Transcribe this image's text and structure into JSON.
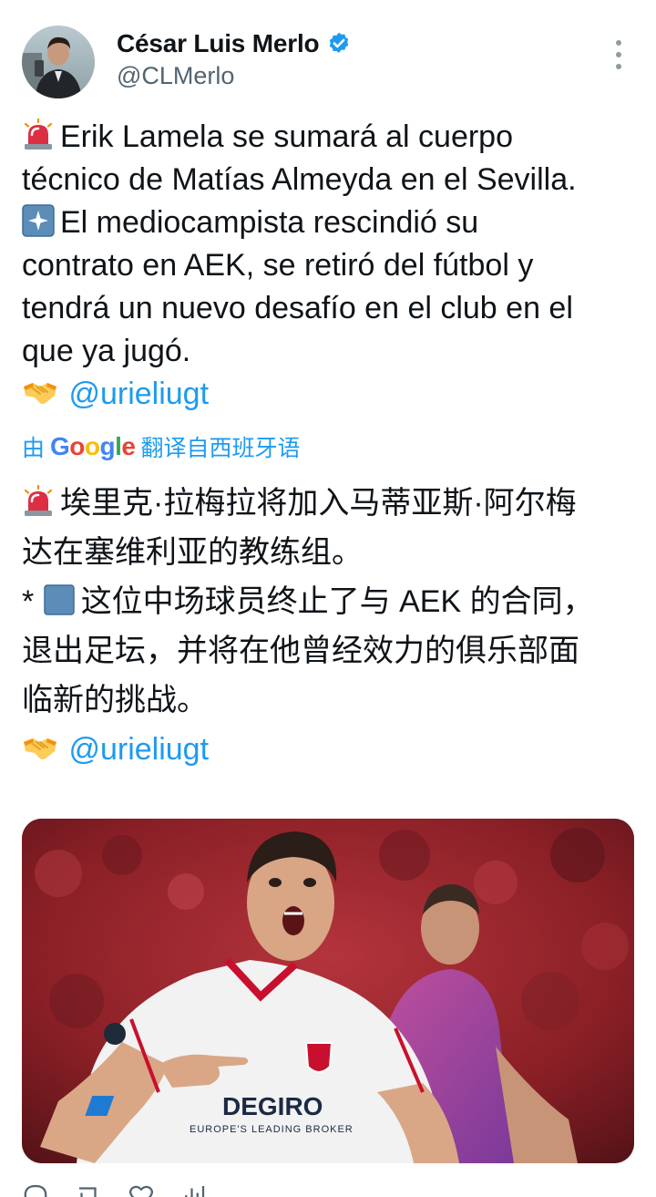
{
  "author": {
    "display_name": "César Luis Merlo",
    "handle": "@CLMerlo",
    "verified": true
  },
  "tweet": {
    "line1": "Erik Lamela se sumará al cuerpo",
    "line2": "técnico de Matías Almeyda en el Sevilla.",
    "line3": "El mediocampista rescindió su",
    "line4": "contrato en AEK, se retiró del fútbol y",
    "line5": "tendrá un nuevo desafío en el club en el",
    "line6": "que ya jugó.",
    "mention": "@urieliugt"
  },
  "translation": {
    "prefix": "由",
    "provider_letters": [
      "G",
      "o",
      "o",
      "g",
      "l",
      "e"
    ],
    "suffix": "翻译自西班牙语",
    "line1": "埃里克·拉梅拉将加入马蒂亚斯·阿尔梅",
    "line2": "达在塞维利亚的教练组。",
    "line3_star": "* ",
    "line3": "这位中场球员终止了与 AEK 的合同，",
    "line4": "退出足坛，并将在他曾经效力的俱乐部面",
    "line5": "临新的挑战。",
    "mention": "@urieliugt"
  },
  "photo": {
    "sponsor": "DEGIRO",
    "sponsor_tagline": "EUROPE'S LEADING BROKER"
  },
  "icons": {
    "alarm": "rotating-light-icon",
    "sparkle": "sparkles-button-icon",
    "handshake": "handshake-icon",
    "verified": "verified-badge-icon",
    "more": "more-vertical-icon"
  },
  "colors": {
    "link": "#1d9bf0",
    "text": "#0f1419",
    "secondary": "#536471",
    "verified": "#1d9bf0"
  }
}
